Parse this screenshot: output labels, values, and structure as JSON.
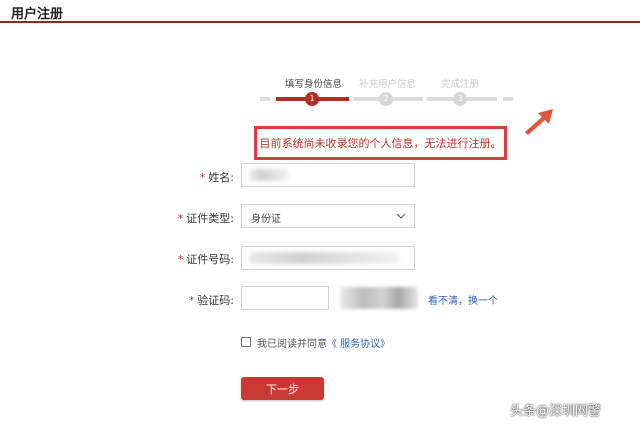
{
  "header": {
    "title": "用户注册"
  },
  "steps": [
    {
      "label": "填写身份信息",
      "number": "1",
      "active": true
    },
    {
      "label": "补充用户信息",
      "number": "2",
      "active": false
    },
    {
      "label": "完成注册",
      "number": "3",
      "active": false
    }
  ],
  "notice": {
    "text": "目前系统尚未收录您的个人信息，无法进行注册。"
  },
  "form": {
    "name": {
      "required_mark": "*",
      "label": "姓名:",
      "value": ""
    },
    "id_type": {
      "required_mark": "*",
      "label": "证件类型:",
      "value": "身份证"
    },
    "id_number": {
      "required_mark": "*",
      "label": "证件号码:",
      "value": ""
    },
    "captcha": {
      "required_mark": "*",
      "label": "验证码:",
      "value": "",
      "refresh_text": "看不清，换一个"
    }
  },
  "agreement": {
    "text": "我已阅读并同意",
    "link_text": "《 服务协议》",
    "checked": false
  },
  "next_button": {
    "label": "下一步"
  },
  "watermark": {
    "text": "头条@深圳网警"
  },
  "colors": {
    "accent": "#b52d22",
    "notice_border": "#d8403a",
    "link": "#2f62b8",
    "arrow": "#e5533c"
  },
  "icons": {
    "arrow": "arrow-icon",
    "chevron": "chevron-down-icon"
  }
}
